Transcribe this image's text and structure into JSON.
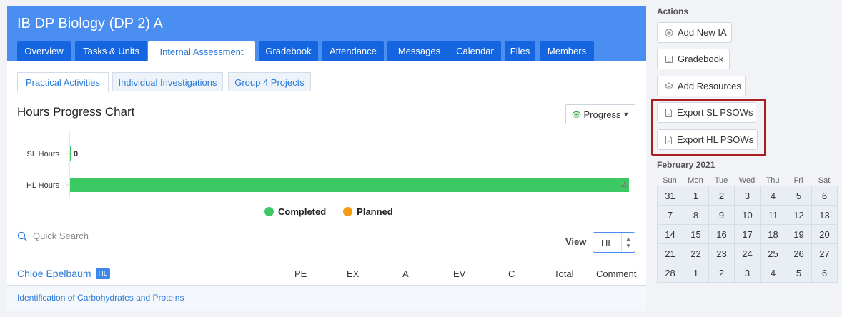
{
  "course": {
    "title": "IB DP Biology (DP 2) A"
  },
  "tabs": [
    {
      "label": "Overview"
    },
    {
      "label": "Tasks & Units"
    },
    {
      "label": "Internal Assessment"
    },
    {
      "label": "Gradebook"
    },
    {
      "label": "Attendance"
    },
    {
      "label": "Messages"
    },
    {
      "label": "Calendar"
    },
    {
      "label": "Files"
    },
    {
      "label": "Members"
    }
  ],
  "subtabs": [
    {
      "label": "Practical Activities"
    },
    {
      "label": "Individual Investigations"
    },
    {
      "label": "Group 4 Projects"
    }
  ],
  "chart_section": {
    "title": "Hours Progress Chart",
    "progress_button": "Progress"
  },
  "chart_data": {
    "type": "bar",
    "orientation": "horizontal",
    "categories": [
      "SL Hours",
      "HL Hours"
    ],
    "series": [
      {
        "name": "Completed",
        "values": [
          0,
          4
        ],
        "color": "#3cc862"
      },
      {
        "name": "Planned",
        "values": [
          0,
          0
        ],
        "color": "#f39c12"
      }
    ],
    "data_labels": [
      "0",
      "4"
    ],
    "xlim": [
      0,
      4
    ]
  },
  "legend": [
    {
      "label": "Completed",
      "color": "#3cc862"
    },
    {
      "label": "Planned",
      "color": "#f39c12"
    }
  ],
  "search": {
    "placeholder": "Quick Search"
  },
  "view": {
    "label": "View",
    "value": "HL"
  },
  "student": {
    "name": "Chloe Epelbaum",
    "badge": "HL"
  },
  "columns": [
    "PE",
    "EX",
    "A",
    "EV",
    "C",
    "Total",
    "Comment"
  ],
  "activities": [
    {
      "title": "Identification of Carbohydrates and Proteins"
    }
  ],
  "actions": {
    "title": "Actions",
    "items": [
      {
        "label": "Add New IA",
        "icon": "plus-circle-icon"
      },
      {
        "label": "Gradebook",
        "icon": "book-icon"
      },
      {
        "label": "Add Resources",
        "icon": "layers-icon"
      },
      {
        "label": "Export SL PSOWs",
        "icon": "pdf-file-icon"
      },
      {
        "label": "Export HL PSOWs",
        "icon": "pdf-file-icon"
      }
    ]
  },
  "calendar": {
    "title": "February 2021",
    "weekdays": [
      "Sun",
      "Mon",
      "Tue",
      "Wed",
      "Thu",
      "Fri",
      "Sat"
    ],
    "days": [
      "31",
      "1",
      "2",
      "3",
      "4",
      "5",
      "6",
      "7",
      "8",
      "9",
      "10",
      "11",
      "12",
      "13",
      "14",
      "15",
      "16",
      "17",
      "18",
      "19",
      "20",
      "21",
      "22",
      "23",
      "24",
      "25",
      "26",
      "27",
      "28",
      "1",
      "2",
      "3",
      "4",
      "5",
      "6"
    ]
  },
  "colors": {
    "header": "#4a8ef2",
    "tab": "#1565e0",
    "accent": "#2a7ad8",
    "highlight": "#a81f1f"
  }
}
